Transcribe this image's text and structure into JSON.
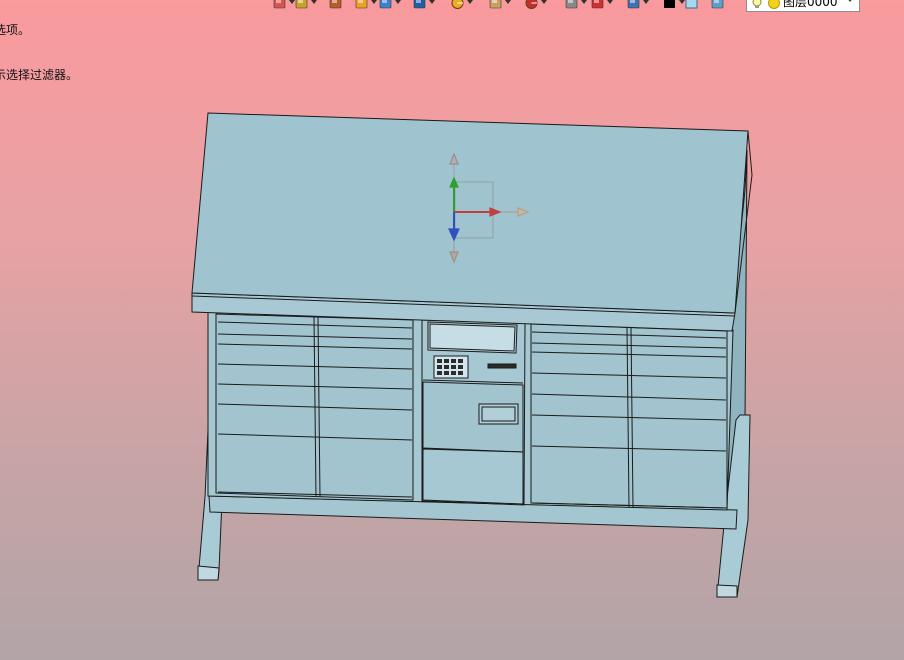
{
  "status": {
    "lines": [
      "选项。",
      "示选择过滤器。"
    ]
  },
  "toolbar": {
    "buttons": [
      {
        "icon": "undo-icon",
        "color": "#d9534f"
      },
      {
        "icon": "layers-icon",
        "color": "#c9a227"
      },
      {
        "icon": "pen-icon",
        "color": "#b85d2a"
      },
      {
        "icon": "solid-box-icon",
        "color": "#f0a020"
      },
      {
        "icon": "cube-icon",
        "color": "#3a7fd0"
      },
      {
        "icon": "cube-blue-icon",
        "color": "#1f5fa8"
      },
      {
        "icon": "pie-icon",
        "color": "#e8b020"
      },
      {
        "icon": "note-icon",
        "color": "#c8a060"
      },
      {
        "icon": "target-icon",
        "color": "#c03030"
      },
      {
        "icon": "page-icon",
        "color": "#888888"
      },
      {
        "icon": "rect-red-icon",
        "color": "#d03030"
      },
      {
        "icon": "monitor-icon",
        "color": "#4070b0"
      },
      {
        "icon": "black-square-icon",
        "color": "#000000"
      },
      {
        "icon": "blue-square-icon",
        "color": "#a8d8f0"
      },
      {
        "icon": "shading-icon",
        "color": "#5aa0c8"
      }
    ],
    "layer_combo": {
      "value": "图层0000"
    }
  },
  "model": {
    "fill_color": "#9fc3cf",
    "edge_color": "#1a1a1a"
  }
}
